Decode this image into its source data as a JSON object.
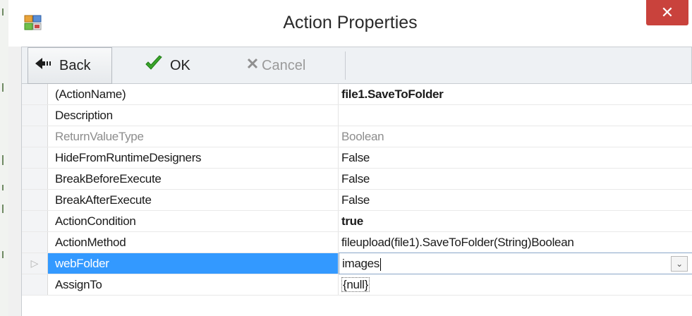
{
  "window": {
    "title": "Action Properties",
    "close_glyph": "✕",
    "icon": "app-form-icon"
  },
  "toolbar": {
    "back_label": "Back",
    "ok_label": "OK",
    "cancel_label": "Cancel",
    "back_icon": "back-arrow-icon",
    "ok_icon": "green-check-icon",
    "cancel_icon": "x-icon"
  },
  "properties": [
    {
      "name": "(ActionName)",
      "value": "file1.SaveToFolder"
    },
    {
      "name": "Description",
      "value": ""
    },
    {
      "name": "ReturnValueType",
      "value": "Boolean"
    },
    {
      "name": "HideFromRuntimeDesigners",
      "value": "False"
    },
    {
      "name": "BreakBeforeExecute",
      "value": "False"
    },
    {
      "name": "BreakAfterExecute",
      "value": "False"
    },
    {
      "name": "ActionCondition",
      "value": "true"
    },
    {
      "name": "ActionMethod",
      "value": "fileupload(file1).SaveToFolder(String)Boolean"
    },
    {
      "name": "webFolder",
      "value": "images"
    },
    {
      "name": "AssignTo",
      "value": "{null}"
    }
  ],
  "expand_glyph": "▷",
  "dropdown_glyph": "⌄",
  "colors": {
    "selection": "#3399ff",
    "close_button": "#c9423c",
    "readonly_text": "#8d8d8d"
  }
}
